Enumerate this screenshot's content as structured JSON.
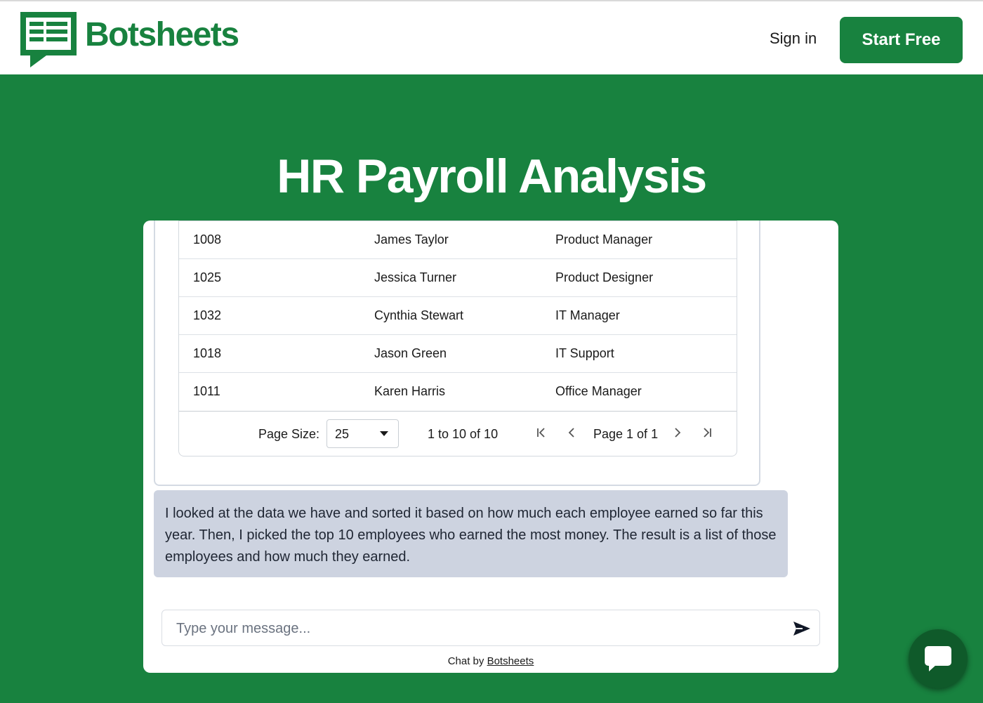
{
  "brand": {
    "name": "Botsheets",
    "color": "#18823f"
  },
  "header": {
    "signin_label": "Sign in",
    "start_free_label": "Start Free"
  },
  "hero": {
    "title": "HR Payroll Analysis"
  },
  "table": {
    "rows": [
      {
        "id": "1008",
        "name": "James Taylor",
        "title": "Product Manager"
      },
      {
        "id": "1025",
        "name": "Jessica Turner",
        "title": "Product Designer"
      },
      {
        "id": "1032",
        "name": "Cynthia Stewart",
        "title": "IT Manager"
      },
      {
        "id": "1018",
        "name": "Jason Green",
        "title": "IT Support"
      },
      {
        "id": "1011",
        "name": "Karen Harris",
        "title": "Office Manager"
      }
    ],
    "pager": {
      "page_size_label": "Page Size:",
      "page_size_value": "25",
      "range_text": "1 to 10 of 10",
      "page_text": "Page 1 of 1",
      "icons": [
        "first-page-icon",
        "prev-page-icon",
        "next-page-icon",
        "last-page-icon"
      ]
    }
  },
  "chat": {
    "bot_message": "I looked at the data we have and sorted it based on how much each employee earned so far this year. Then, I picked the top 10 employees who earned the most money. The result is a list of those employees and how much they earned.",
    "input_placeholder": "Type your message...",
    "credit_prefix": "Chat by",
    "credit_link": "Botsheets"
  }
}
